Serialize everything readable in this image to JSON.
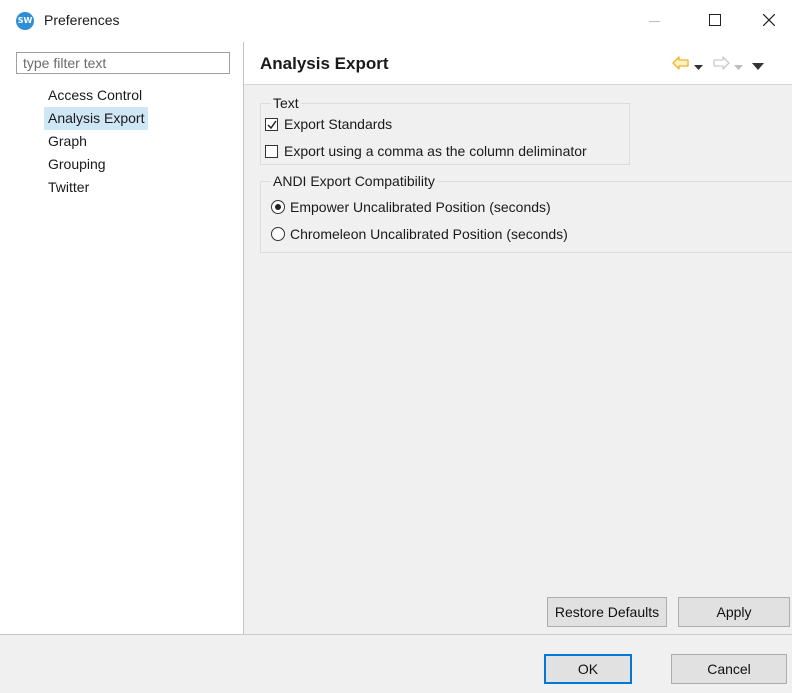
{
  "window": {
    "title": "Preferences",
    "app_icon_label": "SW"
  },
  "sidebar": {
    "filter_placeholder": "type filter text",
    "items": [
      {
        "label": "Access Control"
      },
      {
        "label": "Analysis Export",
        "selected": true
      },
      {
        "label": "Graph"
      },
      {
        "label": "Grouping"
      },
      {
        "label": "Twitter"
      }
    ]
  },
  "content": {
    "title": "Analysis Export",
    "nav_icons": [
      "back-arrow-icon",
      "back-menu-icon",
      "forward-arrow-icon",
      "forward-menu-icon",
      "view-menu-icon"
    ],
    "groups": {
      "text": {
        "label": "Text",
        "options": [
          {
            "label": "Export Standards",
            "checked": true
          },
          {
            "label": "Export using a comma as the column deliminator",
            "checked": false
          }
        ]
      },
      "andi": {
        "label": "ANDI Export Compatibility",
        "options": [
          {
            "label": "Empower Uncalibrated Position (seconds)",
            "selected": true
          },
          {
            "label": "Chromeleon Uncalibrated Position (seconds)",
            "selected": false
          }
        ]
      }
    },
    "buttons": {
      "restore_defaults": "Restore Defaults",
      "apply": "Apply"
    }
  },
  "footer": {
    "ok": "OK",
    "cancel": "Cancel"
  },
  "colors": {
    "selection": "#cfe6f7",
    "accent": "#0078d7",
    "nav_arrow_active": "#f0b429",
    "panel_bg": "#f0f0f0"
  }
}
